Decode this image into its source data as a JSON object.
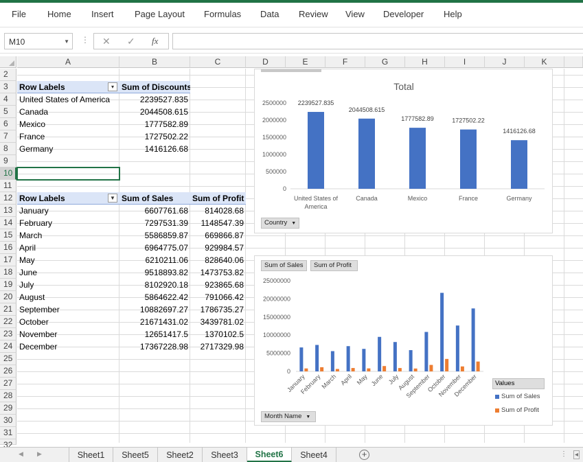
{
  "menu": [
    "File",
    "Home",
    "Insert",
    "Page Layout",
    "Formulas",
    "Data",
    "Review",
    "View",
    "Developer",
    "Help"
  ],
  "formula_bar": {
    "name_box": "M10",
    "separator": "⋮",
    "cancel": "✕",
    "confirm": "✓",
    "fx": "fx",
    "formula": ""
  },
  "columns": [
    "A",
    "B",
    "C",
    "D",
    "E",
    "F",
    "G",
    "H",
    "I",
    "J",
    "K"
  ],
  "rows": [
    "2",
    "3",
    "4",
    "5",
    "6",
    "7",
    "8",
    "9",
    "10",
    "11",
    "12",
    "13",
    "14",
    "15",
    "16",
    "17",
    "18",
    "19",
    "20",
    "21",
    "22",
    "23",
    "24",
    "25",
    "26",
    "27",
    "28",
    "29",
    "30",
    "31",
    "32"
  ],
  "pivot1": {
    "header": [
      "Row Labels",
      "Sum of Discounts"
    ],
    "rows": [
      [
        "United States of America",
        "2239527.835"
      ],
      [
        "Canada",
        "2044508.615"
      ],
      [
        "Mexico",
        "1777582.89"
      ],
      [
        "France",
        "1727502.22"
      ],
      [
        "Germany",
        "1416126.68"
      ]
    ]
  },
  "pivot2": {
    "header": [
      "Row Labels",
      "Sum of  Sales",
      "Sum of Profit"
    ],
    "rows": [
      [
        "January",
        "6607761.68",
        "814028.68"
      ],
      [
        "February",
        "7297531.39",
        "1148547.39"
      ],
      [
        "March",
        "5586859.87",
        "669866.87"
      ],
      [
        "April",
        "6964775.07",
        "929984.57"
      ],
      [
        "May",
        "6210211.06",
        "828640.06"
      ],
      [
        "June",
        "9518893.82",
        "1473753.82"
      ],
      [
        "July",
        "8102920.18",
        "923865.68"
      ],
      [
        "August",
        "5864622.42",
        "791066.42"
      ],
      [
        "September",
        "10882697.27",
        "1786735.27"
      ],
      [
        "October",
        "21671431.02",
        "3439781.02"
      ],
      [
        "November",
        "12651417.5",
        "1370102.5"
      ],
      [
        "December",
        "17367228.98",
        "2717329.98"
      ]
    ]
  },
  "chart_data": [
    {
      "type": "bar",
      "title": "Total",
      "categories": [
        "United States of America",
        "Canada",
        "Mexico",
        "France",
        "Germany"
      ],
      "values": [
        2239527.835,
        2044508.615,
        1777582.89,
        1727502.22,
        1416126.68
      ],
      "data_labels": [
        "2239527.835",
        "2044508.615",
        "1777582.89",
        "1727502.22",
        "1416126.68"
      ],
      "yticks": [
        "0",
        "500000",
        "1000000",
        "1500000",
        "2000000",
        "2500000"
      ],
      "ylim": [
        0,
        2500000
      ],
      "color": "#4472c4",
      "grid": false,
      "field_button": "Country"
    },
    {
      "type": "bar",
      "title": "",
      "categories": [
        "January",
        "February",
        "March",
        "April",
        "May",
        "June",
        "July",
        "August",
        "September",
        "October",
        "November",
        "December"
      ],
      "series": [
        {
          "name": "Sum of  Sales",
          "color": "#4472c4",
          "values": [
            6607761.68,
            7297531.39,
            5586859.87,
            6964775.07,
            6210211.06,
            9518893.82,
            8102920.18,
            5864622.42,
            10882697.27,
            21671431.02,
            12651417.5,
            17367228.98
          ]
        },
        {
          "name": "Sum of Profit",
          "color": "#ed7d31",
          "values": [
            814028.68,
            1148547.39,
            669866.87,
            929984.57,
            828640.06,
            1473753.82,
            923865.68,
            791066.42,
            1786735.27,
            3439781.02,
            1370102.5,
            2717329.98
          ]
        }
      ],
      "yticks": [
        "0",
        "5000000",
        "10000000",
        "15000000",
        "20000000",
        "25000000"
      ],
      "ylim": [
        0,
        25000000
      ],
      "grid": false,
      "legend_title": "Values",
      "legend_position": "right",
      "value_buttons": [
        "Sum of  Sales",
        "Sum of Profit"
      ],
      "field_button": "Month Name"
    }
  ],
  "sheets": [
    "Sheet1",
    "Sheet5",
    "Sheet2",
    "Sheet3",
    "Sheet6",
    "Sheet4"
  ],
  "active_sheet": "Sheet6",
  "add_sheet": "+"
}
